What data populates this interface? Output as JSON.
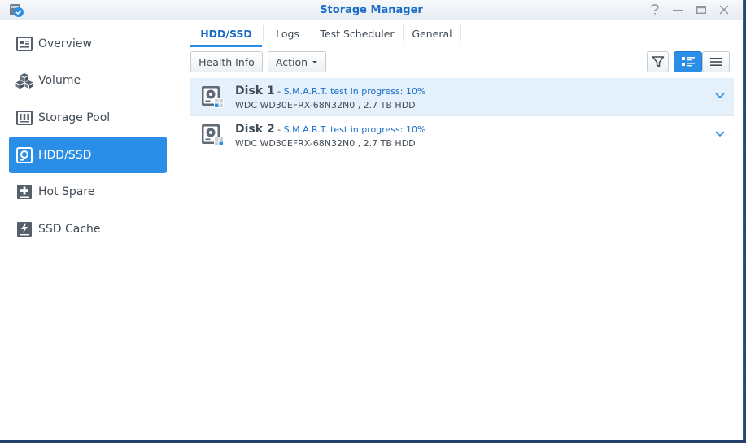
{
  "window": {
    "title": "Storage Manager"
  },
  "title_controls": [
    "help-icon",
    "minimize-icon",
    "maximize-icon",
    "close-icon"
  ],
  "sidebar": {
    "items": [
      {
        "label": "Overview",
        "icon": "overview-icon",
        "active": false
      },
      {
        "label": "Volume",
        "icon": "volume-icon",
        "active": false
      },
      {
        "label": "Storage Pool",
        "icon": "storage-pool-icon",
        "active": false
      },
      {
        "label": "HDD/SSD",
        "icon": "hdd-icon",
        "active": true
      },
      {
        "label": "Hot Spare",
        "icon": "hot-spare-icon",
        "active": false
      },
      {
        "label": "SSD Cache",
        "icon": "ssd-cache-icon",
        "active": false
      }
    ]
  },
  "tabs": [
    {
      "label": "HDD/SSD",
      "active": true
    },
    {
      "label": "Logs",
      "active": false
    },
    {
      "label": "Test Scheduler",
      "active": false
    },
    {
      "label": "General",
      "active": false
    }
  ],
  "toolbar": {
    "health_info_label": "Health Info",
    "action_label": "Action"
  },
  "disks": [
    {
      "name": "Disk 1",
      "separator": " - ",
      "status": "S.M.A.R.T. test in progress: 10%",
      "model": "WDC WD30EFRX-68N32N0 , 2.7 TB HDD",
      "selected": true
    },
    {
      "name": "Disk 2",
      "separator": " - ",
      "status": "S.M.A.R.T. test in progress: 10%",
      "model": "WDC WD30EFRX-68N32N0 , 2.7 TB HDD",
      "selected": false
    }
  ],
  "colors": {
    "accent": "#2b8ee6",
    "title_blue": "#1a6cc8",
    "selected_row": "#e4f1fb",
    "text": "#414b55"
  }
}
